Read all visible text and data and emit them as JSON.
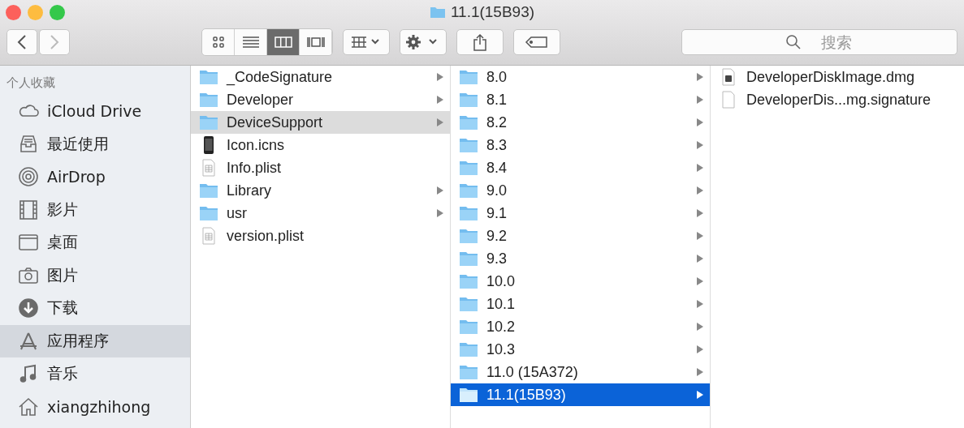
{
  "window": {
    "title": "11.1(15B93)"
  },
  "toolbar": {
    "view_modes": [
      {
        "kind": "icons",
        "selected": false
      },
      {
        "kind": "list",
        "selected": false
      },
      {
        "kind": "columns",
        "selected": true
      },
      {
        "kind": "gallery",
        "selected": false
      }
    ],
    "search": {
      "placeholder": "搜索"
    }
  },
  "sidebar": {
    "heading": "个人收藏",
    "items": [
      {
        "label": "iCloud Drive",
        "kind": "cloud",
        "selected": false
      },
      {
        "label": "最近使用",
        "kind": "recents",
        "selected": false
      },
      {
        "label": "AirDrop",
        "kind": "airdrop",
        "selected": false
      },
      {
        "label": "影片",
        "kind": "movies",
        "selected": false
      },
      {
        "label": "桌面",
        "kind": "desktop",
        "selected": false
      },
      {
        "label": "图片",
        "kind": "pictures",
        "selected": false
      },
      {
        "label": "下载",
        "kind": "downloads",
        "selected": false
      },
      {
        "label": "应用程序",
        "kind": "apps",
        "selected": true
      },
      {
        "label": "音乐",
        "kind": "music",
        "selected": false
      },
      {
        "label": "xiangzhihong",
        "kind": "home",
        "selected": false
      }
    ]
  },
  "columns": [
    {
      "items": [
        {
          "name": "_CodeSignature",
          "kind": "folder",
          "selected": false
        },
        {
          "name": "Developer",
          "kind": "folder",
          "selected": false
        },
        {
          "name": "DeviceSupport",
          "kind": "folder",
          "selected": true
        },
        {
          "name": "Icon.icns",
          "kind": "phone",
          "selected": false
        },
        {
          "name": "Info.plist",
          "kind": "plist",
          "selected": false
        },
        {
          "name": "Library",
          "kind": "folder",
          "selected": false
        },
        {
          "name": "usr",
          "kind": "folder",
          "selected": false
        },
        {
          "name": "version.plist",
          "kind": "plist",
          "selected": false
        }
      ]
    },
    {
      "items": [
        {
          "name": "8.0",
          "kind": "folder",
          "selected": false
        },
        {
          "name": "8.1",
          "kind": "folder",
          "selected": false
        },
        {
          "name": "8.2",
          "kind": "folder",
          "selected": false
        },
        {
          "name": "8.3",
          "kind": "folder",
          "selected": false
        },
        {
          "name": "8.4",
          "kind": "folder",
          "selected": false
        },
        {
          "name": "9.0",
          "kind": "folder",
          "selected": false
        },
        {
          "name": "9.1",
          "kind": "folder",
          "selected": false
        },
        {
          "name": "9.2",
          "kind": "folder",
          "selected": false
        },
        {
          "name": "9.3",
          "kind": "folder",
          "selected": false
        },
        {
          "name": "10.0",
          "kind": "folder",
          "selected": false
        },
        {
          "name": "10.1",
          "kind": "folder",
          "selected": false
        },
        {
          "name": "10.2",
          "kind": "folder",
          "selected": false
        },
        {
          "name": "10.3",
          "kind": "folder",
          "selected": false
        },
        {
          "name": "11.0 (15A372)",
          "kind": "folder",
          "selected": false
        },
        {
          "name": "11.1(15B93)",
          "kind": "folder",
          "selected": true
        }
      ]
    },
    {
      "items": [
        {
          "name": "DeveloperDiskImage.dmg",
          "kind": "disk",
          "selected": false
        },
        {
          "name": "DeveloperDis...mg.signature",
          "kind": "blank",
          "selected": false
        }
      ]
    }
  ]
}
